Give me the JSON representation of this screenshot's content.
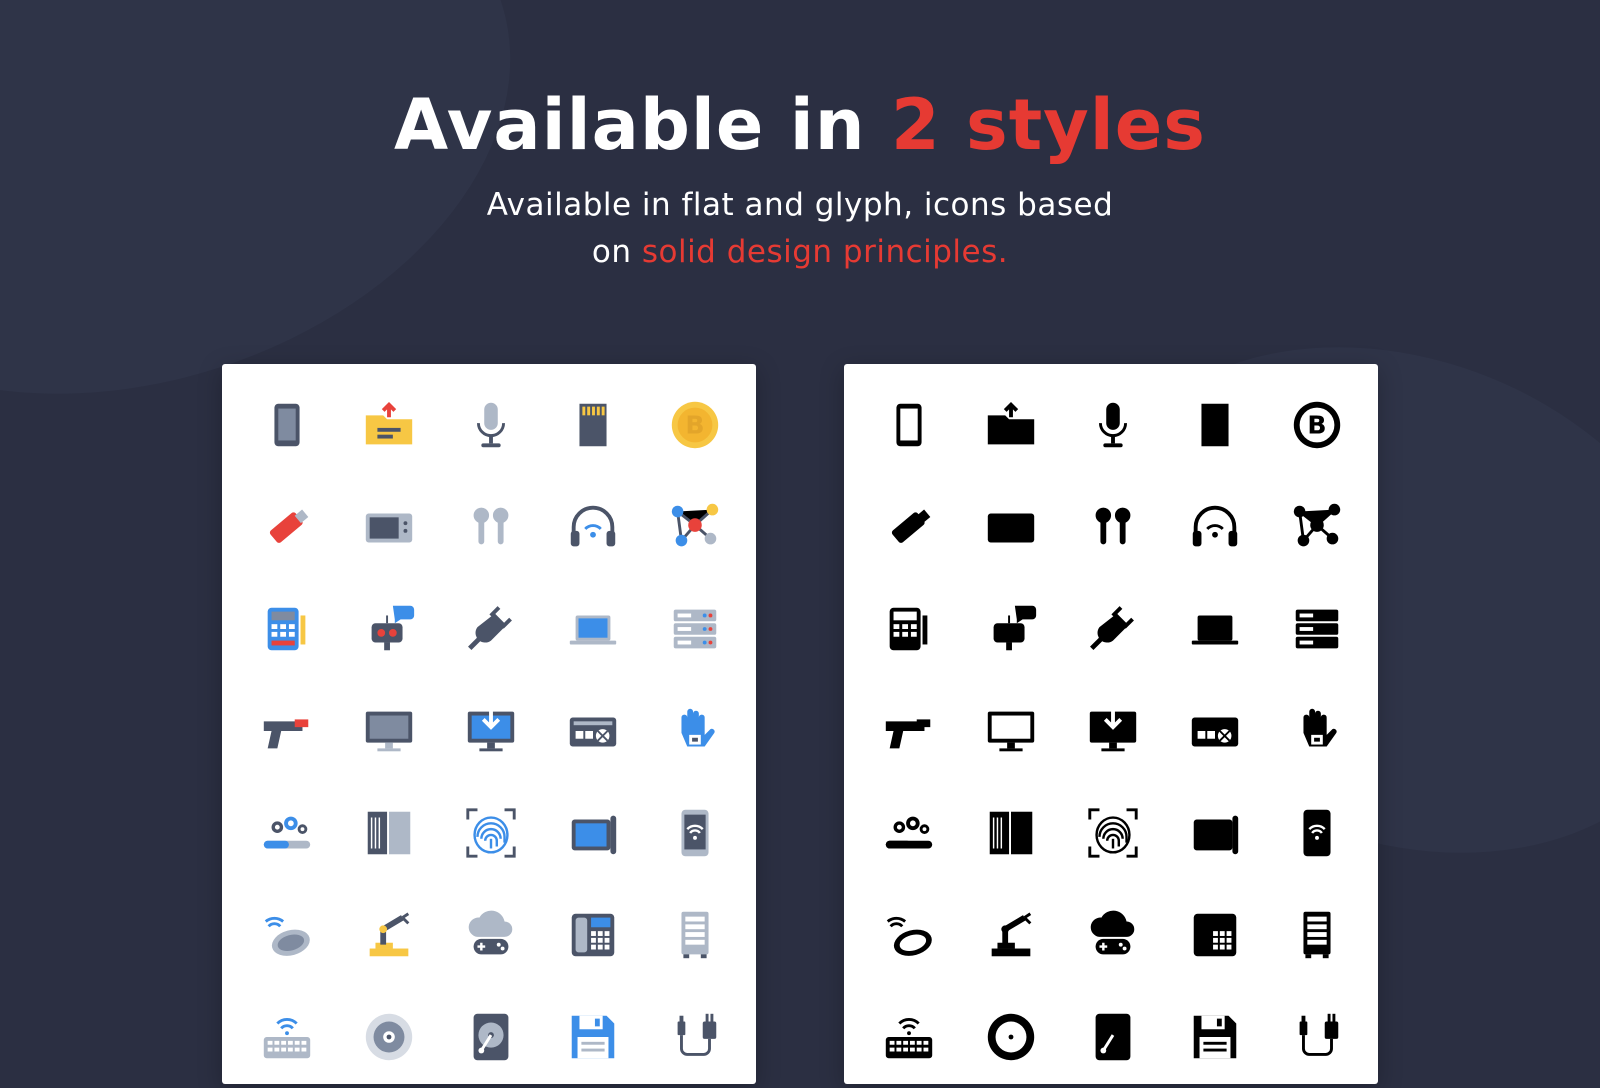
{
  "header": {
    "title_main": "Available in ",
    "title_accent": "2 styles",
    "subtitle_line1": "Available in flat and glyph, icons based",
    "subtitle_line2_prefix": "on ",
    "subtitle_line2_accent": "solid design principles."
  },
  "colors": {
    "background": "#2b2f42",
    "accent": "#e63a33",
    "panel": "#ffffff",
    "glyph_fill": "#000000"
  },
  "styles": [
    {
      "id": "flat",
      "label": "flat"
    },
    {
      "id": "glyph",
      "label": "glyph"
    }
  ],
  "icons": [
    "tablet-icon",
    "folder-upload-icon",
    "microphone-icon",
    "memory-card-icon",
    "bitcoin-icon",
    "usb-drive-icon",
    "microwave-icon",
    "earbuds-icon",
    "wireless-headphones-icon",
    "network-nodes-icon",
    "pos-terminal-icon",
    "robot-icon",
    "power-plug-icon",
    "laptop-icon",
    "server-rack-icon",
    "gun-icon",
    "monitor-icon",
    "download-monitor-icon",
    "power-supply-icon",
    "smart-glove-icon",
    "settings-progress-icon",
    "server-cabinet-icon",
    "fingerprint-scan-icon",
    "drawing-tablet-icon",
    "smartphone-wifi-icon",
    "wireless-mouse-icon",
    "robotic-arm-icon",
    "cloud-gaming-icon",
    "desk-phone-icon",
    "server-tower-icon",
    "wireless-keyboard-icon",
    "compact-disc-icon",
    "hard-drive-icon",
    "floppy-disk-icon",
    "usb-cable-icon"
  ]
}
